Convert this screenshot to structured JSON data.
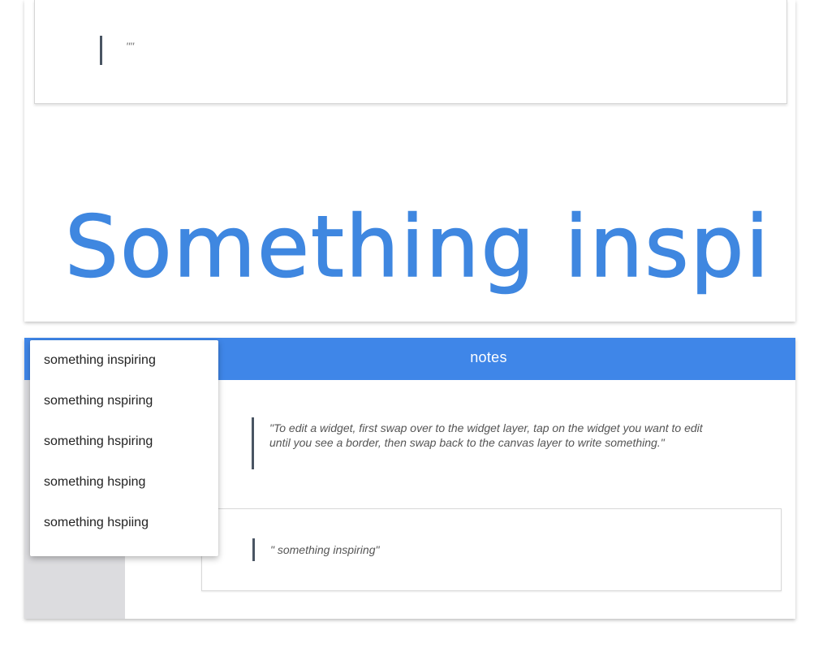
{
  "top_panel": {
    "quote_text": "\"\"",
    "handwriting_text": "Something inspiring"
  },
  "notes_app": {
    "title": "notes",
    "block_quote_text": "\"To edit a widget, first swap over to the widget layer, tap on the widget you want to edit until you see a border, then swap back to the canvas layer to write something.\"",
    "quote_card_text": "\" something inspiring\""
  },
  "suggestions": {
    "items": [
      {
        "label": "something inspiring"
      },
      {
        "label": "something nspiring"
      },
      {
        "label": "something hspiring"
      },
      {
        "label": "something hsping"
      },
      {
        "label": "something hspiing"
      }
    ]
  },
  "colors": {
    "app_bar": "#3f86e8",
    "ink": "#3f87e0",
    "quote_bar": "#4a5563",
    "side_strip": "#dcdcdf"
  }
}
